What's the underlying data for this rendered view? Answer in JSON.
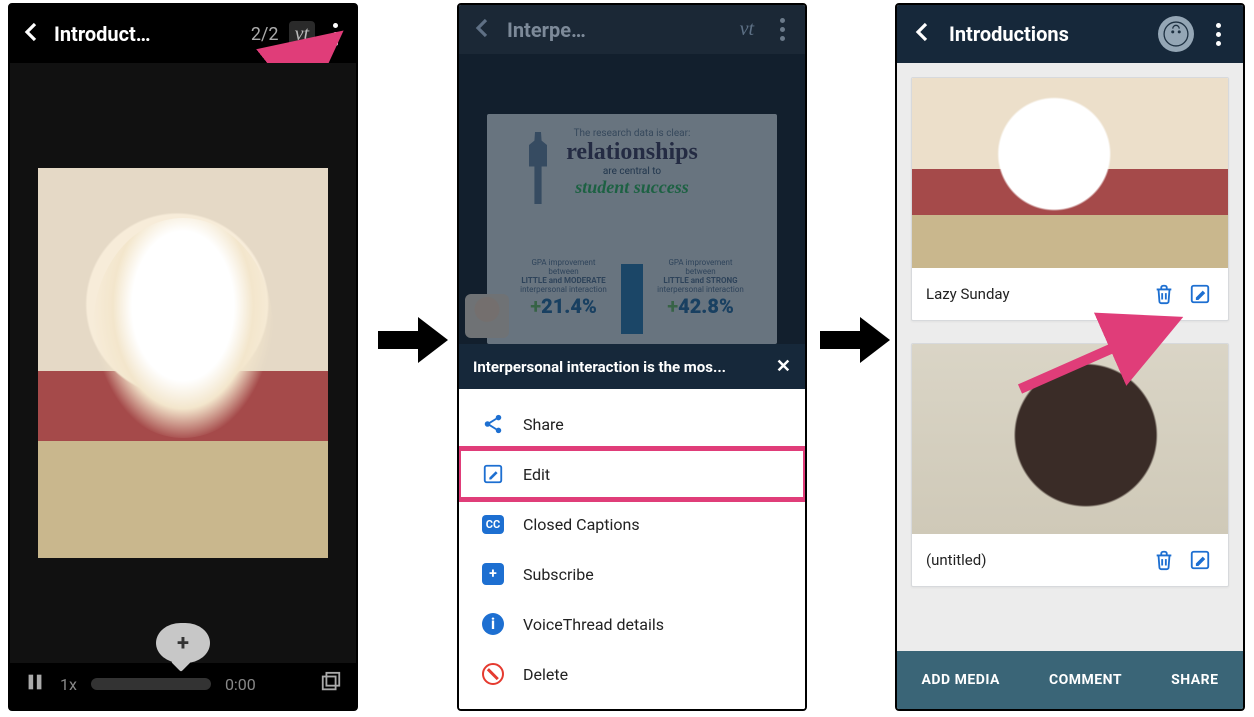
{
  "screen1": {
    "title": "Introduct…",
    "counter": "2/2",
    "vt": "vt",
    "speed": "1x",
    "time": "0:00",
    "comment_plus": "+"
  },
  "screen2": {
    "title": "Interpe…",
    "vt": "vt",
    "infocard": {
      "line1": "The research data is clear:",
      "big": "relationships",
      "line2": "are central to",
      "success": "student success",
      "col1_t1": "GPA improvement",
      "col1_t2": "between",
      "col1_t3": "LITTLE and MODERATE",
      "col1_t4": "interpersonal interaction",
      "col1_pct_plus": "+",
      "col1_pct": "21.4%",
      "col2_t1": "GPA improvement",
      "col2_t2": "between",
      "col2_t3": "LITTLE and STRONG",
      "col2_t4": "interpersonal interaction",
      "col2_pct_plus": "+",
      "col2_pct": "42.8%"
    },
    "caption": "Interpersonal interaction is the mos...",
    "close": "✕",
    "menu": {
      "share": "Share",
      "edit": "Edit",
      "cc": "Closed Captions",
      "cc_badge": "CC",
      "subscribe": "Subscribe",
      "sub_badge": "+",
      "details": "VoiceThread details",
      "info_badge": "i",
      "delete": "Delete"
    }
  },
  "screen3": {
    "title": "Introductions",
    "cards": [
      {
        "label": "Lazy Sunday"
      },
      {
        "label": "(untitled)"
      }
    ],
    "footer": {
      "add": "ADD MEDIA",
      "comment": "COMMENT",
      "share": "SHARE"
    }
  }
}
